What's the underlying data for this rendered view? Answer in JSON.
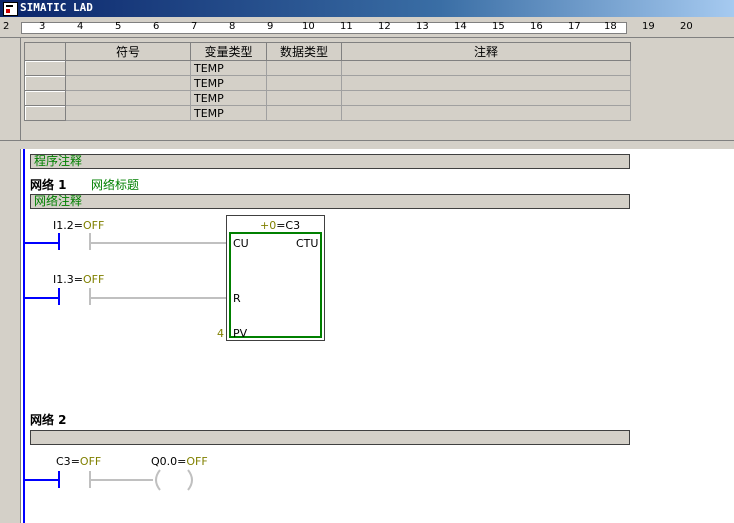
{
  "window": {
    "title": "SIMATIC LAD"
  },
  "ruler": {
    "ticks": [
      "2",
      "3",
      "4",
      "5",
      "6",
      "7",
      "8",
      "9",
      "10",
      "11",
      "12",
      "13",
      "14",
      "15",
      "16",
      "17",
      "18",
      "19",
      "20"
    ]
  },
  "variable_table": {
    "headers": [
      "符号",
      "变量类型",
      "数据类型",
      "注释"
    ],
    "rows": [
      {
        "symbol": "",
        "var_type": "TEMP",
        "data_type": "",
        "comment": ""
      },
      {
        "symbol": "",
        "var_type": "TEMP",
        "data_type": "",
        "comment": ""
      },
      {
        "symbol": "",
        "var_type": "TEMP",
        "data_type": "",
        "comment": ""
      },
      {
        "symbol": "",
        "var_type": "TEMP",
        "data_type": "",
        "comment": ""
      }
    ]
  },
  "program": {
    "comment": "程序注释",
    "networks": [
      {
        "label": "网络 1",
        "title": "网络标题",
        "comment": "网络注释",
        "contacts": [
          {
            "name": "I1.2",
            "eq": "=",
            "state": "OFF"
          },
          {
            "name": "I1.3",
            "eq": "=",
            "state": "OFF"
          }
        ],
        "counter": {
          "header_value": "+0",
          "header_name": "=C3",
          "type": "CTU",
          "pin_cu": "CU",
          "pin_r": "R",
          "pin_pv": "PV",
          "pv_value": "4"
        }
      },
      {
        "label": "网络 2",
        "title": "",
        "comment": "",
        "contact": {
          "name": "C3",
          "eq": "=",
          "state": "OFF"
        },
        "coil": {
          "name": "Q0.0",
          "eq": "=",
          "state": "OFF"
        }
      }
    ]
  }
}
